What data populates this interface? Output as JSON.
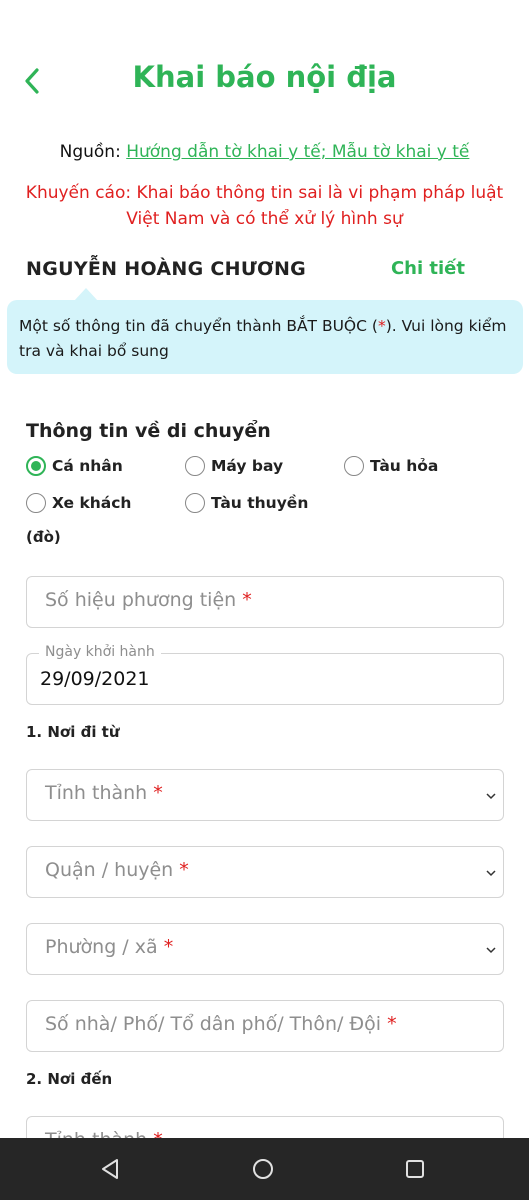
{
  "header": {
    "title": "Khai báo nội địa"
  },
  "source": {
    "label": "Nguồn",
    "separator": ": ",
    "links": "Hướng dẫn tờ khai y tế; Mẫu tờ khai y tế"
  },
  "warning": "Khuyến cáo: Khai báo thông tin sai là vi phạm pháp luật Việt Nam và có thể xử lý hình sự",
  "user": {
    "name": "NGUYỄN HOÀNG CHƯƠNG",
    "detail_link": "Chi tiết"
  },
  "notice": {
    "text_before": "Một số thông tin đã chuyển thành BẮT BUỘC (",
    "star": "*",
    "text_after": "). Vui lòng kiểm tra và khai bổ sung"
  },
  "travel": {
    "title": "Thông tin về di chuyển",
    "options": [
      {
        "label": "Cá nhân",
        "checked": true
      },
      {
        "label": "Máy bay",
        "checked": false
      },
      {
        "label": "Tàu hỏa",
        "checked": false
      },
      {
        "label": "Xe khách",
        "checked": false
      },
      {
        "label": "Tàu thuyền",
        "checked": false
      }
    ],
    "option_suffix": "(đò)"
  },
  "fields": {
    "vehicle_number": {
      "placeholder": "Số hiệu phương tiện",
      "required": "*"
    },
    "departure_date": {
      "label": "Ngày khởi hành",
      "value": "29/09/2021"
    }
  },
  "from": {
    "title": "1. Nơi đi từ",
    "province": {
      "placeholder": "Tỉnh thành",
      "required": "*"
    },
    "district": {
      "placeholder": "Quận / huyện",
      "required": "*"
    },
    "ward": {
      "placeholder": "Phường / xã",
      "required": "*"
    },
    "address": {
      "placeholder": "Số nhà/ Phố/ Tổ dân phố/ Thôn/ Đội",
      "required": "*"
    }
  },
  "to": {
    "title": "2. Nơi đến",
    "province": {
      "placeholder": "Tỉnh thành",
      "required": "*"
    }
  },
  "colors": {
    "accent": "#2fb457",
    "warning": "#e02020",
    "notice_bg": "#d4f4fa"
  },
  "icons": {
    "back": "chevron-left-icon",
    "dropdown": "chevron-down-icon",
    "nav_back": "triangle-back-icon",
    "nav_home": "circle-home-icon",
    "nav_recents": "square-recents-icon"
  }
}
